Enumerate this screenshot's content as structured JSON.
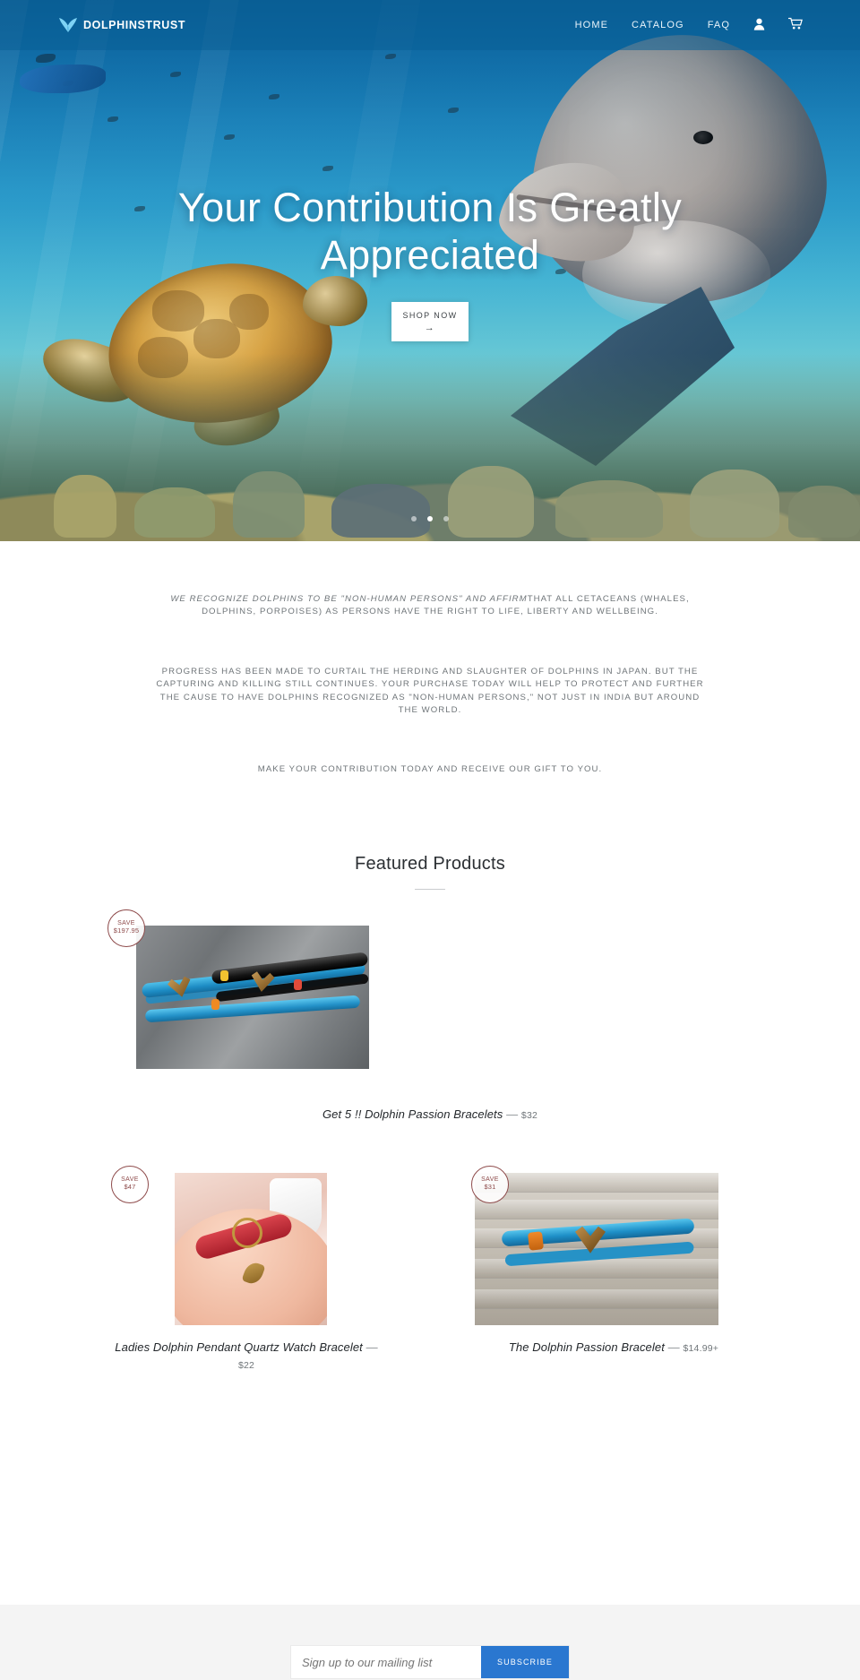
{
  "header": {
    "brand_name": "DOLPHINSTRUST",
    "logo_icon": "dolphin-fluke-icon",
    "nav": [
      {
        "label": "HOME"
      },
      {
        "label": "CATALOG"
      },
      {
        "label": "FAQ"
      }
    ],
    "account_icon": "user-account-icon",
    "cart_icon": "shopping-cart-icon"
  },
  "hero": {
    "title": "Your Contribution Is Greatly Appreciated",
    "cta_label": "SHOP NOW",
    "cta_arrow": "→",
    "slides": 3,
    "active_slide": 2
  },
  "intro": {
    "p1_italic": "WE RECOGNIZE DOLPHINS TO BE \"NON-HUMAN PERSONS\"  AND AFFIRM",
    "p1_rest": "THAT ALL CETACEANS (WHALES, DOLPHINS, PORPOISES) AS PERSONS HAVE THE RIGHT TO LIFE, LIBERTY AND WELLBEING.",
    "p2": "PROGRESS HAS BEEN MADE TO CURTAIL THE HERDING AND SLAUGHTER OF DOLPHINS IN JAPAN.  BUT THE CAPTURING AND KILLING STILL CONTINUES. YOUR PURCHASE TODAY WILL HELP TO PROTECT AND FURTHER THE CAUSE TO HAVE DOLPHINS RECOGNIZED AS \"NON-HUMAN PERSONS,\"  NOT JUST IN INDIA BUT AROUND THE WORLD.",
    "p3": "MAKE YOUR CONTRIBUTION TODAY AND RECEIVE OUR GIFT TO YOU."
  },
  "featured": {
    "heading": "Featured Products",
    "products": [
      {
        "title": "Get 5 !! Dolphin Passion Bracelets",
        "dash": "—",
        "price": "$32",
        "badge_label": "SAVE",
        "badge_amount": "$197.95"
      },
      {
        "title": "Ladies Dolphin Pendant Quartz Watch Bracelet",
        "dash": "—",
        "price": "$22",
        "badge_label": "SAVE",
        "badge_amount": "$47"
      },
      {
        "title": "The Dolphin Passion Bracelet",
        "dash": "—",
        "price": "$14.99+",
        "badge_label": "SAVE",
        "badge_amount": "$31"
      }
    ]
  },
  "newsletter": {
    "placeholder": "Sign up to our mailing list",
    "value": "",
    "button_label": "SUBSCRIBE"
  },
  "colors": {
    "header_blue": "#095f96",
    "badge_red": "#8e4b4b",
    "subscribe_blue": "#2a77d0",
    "body_text": "#6f7579"
  }
}
